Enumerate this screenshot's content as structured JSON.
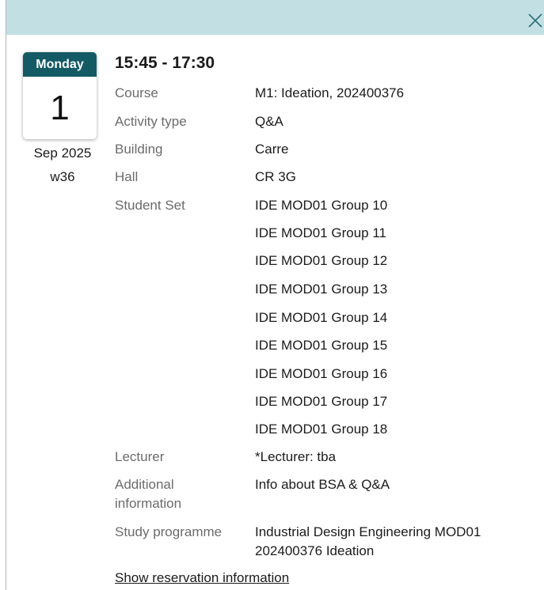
{
  "date": {
    "weekday": "Monday",
    "day": "1",
    "month_year": "Sep 2025",
    "week": "w36"
  },
  "time_range": "15:45 - 17:30",
  "details": {
    "course_label": "Course",
    "course_value": "M1: Ideation, 202400376",
    "activity_label": "Activity type",
    "activity_value": "Q&A",
    "building_label": "Building",
    "building_value": "Carre",
    "hall_label": "Hall",
    "hall_value": "CR 3G",
    "student_set_label": "Student Set",
    "student_sets": [
      "IDE MOD01 Group 10",
      "IDE MOD01 Group 11",
      "IDE MOD01 Group 12",
      "IDE MOD01 Group 13",
      "IDE MOD01 Group 14",
      "IDE MOD01 Group 15",
      "IDE MOD01 Group 16",
      "IDE MOD01 Group 17",
      "IDE MOD01 Group 18"
    ],
    "lecturer_label": "Lecturer",
    "lecturer_value": "*Lecturer: tba",
    "additional_label_1": "Additional",
    "additional_label_2": "information",
    "additional_value": "Info about BSA & Q&A",
    "programme_label": "Study programme",
    "programme_value_1": "Industrial Design Engineering MOD01",
    "programme_value_2": "202400376 Ideation"
  },
  "actions": {
    "show_reservation": "Show reservation information"
  },
  "icons": {
    "close": "close-icon"
  },
  "colors": {
    "header_band": "#c2e0e3",
    "weekday_band": "#135a65",
    "label_text": "#6b6b6b"
  }
}
